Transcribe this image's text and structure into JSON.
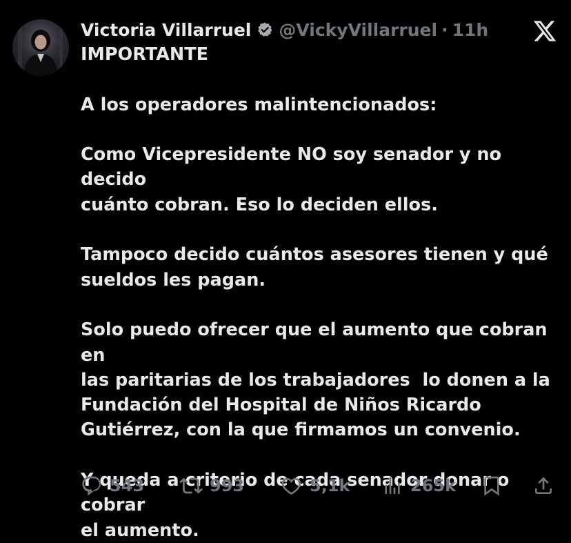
{
  "tweet": {
    "author_name": "Victoria Villarruel",
    "handle": "@VickyVillarruel",
    "separator": "·",
    "time": "11h",
    "text": "IMPORTANTE\n\nA los operadores malintencionados:\n\nComo Vicepresidente NO soy senador y no decido\ncuánto cobran. Eso lo deciden ellos.\n\nTampoco decido cuántos asesores tienen y qué\nsueldos les pagan.\n\nSolo puedo ofrecer que el aumento que cobran en\nlas paritarias de los trabajadores  lo donen a la\nFundación del Hospital de Niños Ricardo\nGutiérrez, con la que firmamos un convenio.\n\nY queda a criterio de cada senador donar o cobrar\nel aumento."
  },
  "actions": {
    "replies": "543",
    "reposts": "993",
    "likes": "5,1k",
    "views": "265k"
  },
  "icons": {
    "verified": "verified-badge-icon",
    "brand": "x-logo-icon",
    "reply": "reply-icon",
    "repost": "repost-icon",
    "like": "heart-icon",
    "views": "views-chart-icon",
    "bookmark": "bookmark-icon",
    "share": "share-icon"
  },
  "colors": {
    "background": "#000000",
    "text": "#e7e9ea",
    "secondary": "#71767b"
  }
}
